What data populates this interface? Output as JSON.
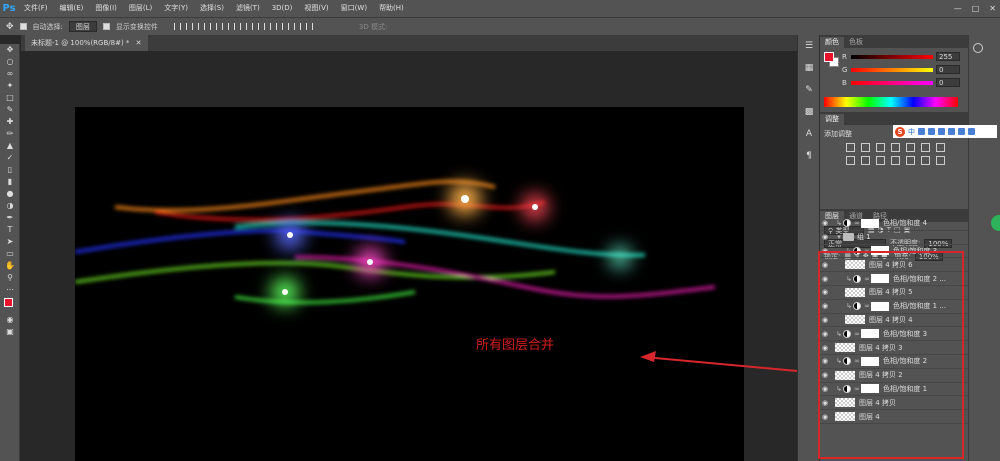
{
  "app": {
    "logo": "Ps"
  },
  "menu": [
    "文件(F)",
    "编辑(E)",
    "图像(I)",
    "图层(L)",
    "文字(Y)",
    "选择(S)",
    "滤镜(T)",
    "3D(D)",
    "视图(V)",
    "窗口(W)",
    "帮助(H)"
  ],
  "options_bar": {
    "auto_select_label": "自动选择:",
    "auto_select_value": "图层",
    "show_transform_label": "显示变换控件",
    "mode_3d_label": "3D 模式:"
  },
  "document": {
    "tab_title": "未标题-1 @ 100%(RGB/8#) *"
  },
  "annotation": {
    "text": "所有图层合并"
  },
  "color_panel": {
    "tabs": [
      "颜色",
      "色板"
    ],
    "sliders": [
      {
        "label": "R",
        "value": "255"
      },
      {
        "label": "G",
        "value": "0"
      },
      {
        "label": "B",
        "value": "0"
      }
    ],
    "fg_color": "#e8132b"
  },
  "adjustments_panel": {
    "tabs": [
      "调整"
    ],
    "label": "添加调整"
  },
  "sogou": {
    "text": "中"
  },
  "layers_panel": {
    "tabs": [
      "图层",
      "通道",
      "路径"
    ],
    "filter_label": "类型",
    "blend_mode": "正常",
    "opacity_label": "不透明度:",
    "opacity_value": "100%",
    "lock_label": "锁定:",
    "fill_label": "填充:",
    "fill_value": "100%",
    "layers": [
      {
        "name": "色相/饱和度 4",
        "kind": "adjustment",
        "indent": 0
      },
      {
        "name": "组 1",
        "kind": "group",
        "indent": 0
      },
      {
        "name": "色相/饱和度 3 ...",
        "kind": "adjustment",
        "indent": 1
      },
      {
        "name": "图层 4 拷贝 6",
        "kind": "pixel",
        "indent": 1
      },
      {
        "name": "色相/饱和度 2 ...",
        "kind": "adjustment",
        "indent": 1
      },
      {
        "name": "图层 4 拷贝 5",
        "kind": "pixel",
        "indent": 1
      },
      {
        "name": "色相/饱和度 1 ...",
        "kind": "adjustment",
        "indent": 1
      },
      {
        "name": "图层 4 拷贝 4",
        "kind": "pixel",
        "indent": 1
      },
      {
        "name": "色相/饱和度 3",
        "kind": "adjustment",
        "indent": 0
      },
      {
        "name": "图层 4 拷贝 3",
        "kind": "pixel",
        "indent": 0
      },
      {
        "name": "色相/饱和度 2",
        "kind": "adjustment",
        "indent": 0
      },
      {
        "name": "图层 4 拷贝 2",
        "kind": "pixel",
        "indent": 0
      },
      {
        "name": "色相/饱和度 1",
        "kind": "adjustment",
        "indent": 0
      },
      {
        "name": "图层 4 拷贝",
        "kind": "pixel",
        "indent": 0
      },
      {
        "name": "图层 4",
        "kind": "pixel",
        "indent": 0
      }
    ]
  },
  "highlight_color": "#d7262b"
}
